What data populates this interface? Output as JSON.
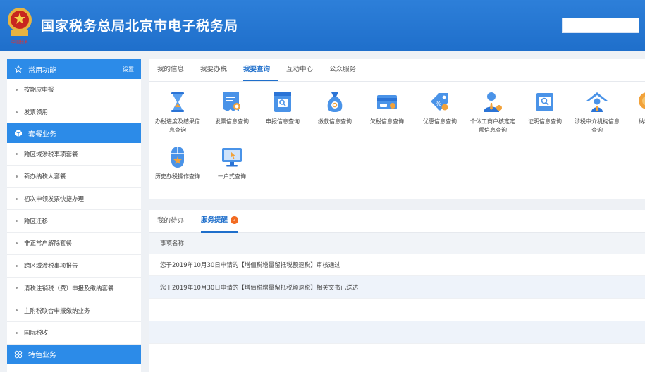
{
  "header": {
    "title": "国家税务总局北京市电子税务局",
    "emblem_text": "中国税务"
  },
  "sidebar": {
    "groups": [
      {
        "label": "常用功能",
        "setting": "设置",
        "icon": "star-icon",
        "items": [
          "按期应申报",
          "发票领用"
        ]
      },
      {
        "label": "套餐业务",
        "icon": "cube-icon",
        "items": [
          "跨区域涉税事项套餐",
          "新办纳税人套餐",
          "初次申领发票快捷办理",
          "跨区迁移",
          "非正常户解除套餐",
          "跨区域涉税事项报告",
          "清税注销税（费）申报及缴纳套餐",
          "主附税联合申报缴纳业务",
          "国际税收"
        ]
      },
      {
        "label": "特色业务",
        "icon": "grid-icon",
        "items": []
      }
    ]
  },
  "main": {
    "tabs": [
      "我的信息",
      "我要办税",
      "我要查询",
      "互动中心",
      "公众服务"
    ],
    "active_tab": "我要查询",
    "services": [
      {
        "label": "办税进度及结果信息查询",
        "icon": "hourglass-icon"
      },
      {
        "label": "发票信息查询",
        "icon": "receipt-icon"
      },
      {
        "label": "申报信息查询",
        "icon": "document-search-icon"
      },
      {
        "label": "缴款信息查询",
        "icon": "money-bag-icon"
      },
      {
        "label": "欠税信息查询",
        "icon": "card-icon"
      },
      {
        "label": "优惠信息查询",
        "icon": "discount-tag-icon"
      },
      {
        "label": "个体工商户核定定额信息查询",
        "icon": "person-icon"
      },
      {
        "label": "证明信息查询",
        "icon": "certificate-icon"
      },
      {
        "label": "涉税中介机构信息查询",
        "icon": "house-person-icon"
      },
      {
        "label": "纳税信",
        "icon": "coin-icon"
      },
      {
        "label": "历史办税操作查询",
        "icon": "mouse-icon"
      },
      {
        "label": "一户式查询",
        "icon": "monitor-icon"
      }
    ],
    "todo": {
      "tabs": [
        "我的待办",
        "服务提醒"
      ],
      "active_tab": "服务提醒",
      "badge": "2",
      "column": "事项名称",
      "rows": [
        "您于2019年10月30日申请的【增值税增量留抵税额退税】审核通过",
        "您于2019年10月30日申请的【增值税增量留抵税额退税】相关文书已送达",
        "",
        ""
      ]
    }
  },
  "colors": {
    "brand_blue": "#1f6fcb",
    "sidebar_blue": "#2c8be8",
    "badge_orange": "#f26b22"
  }
}
